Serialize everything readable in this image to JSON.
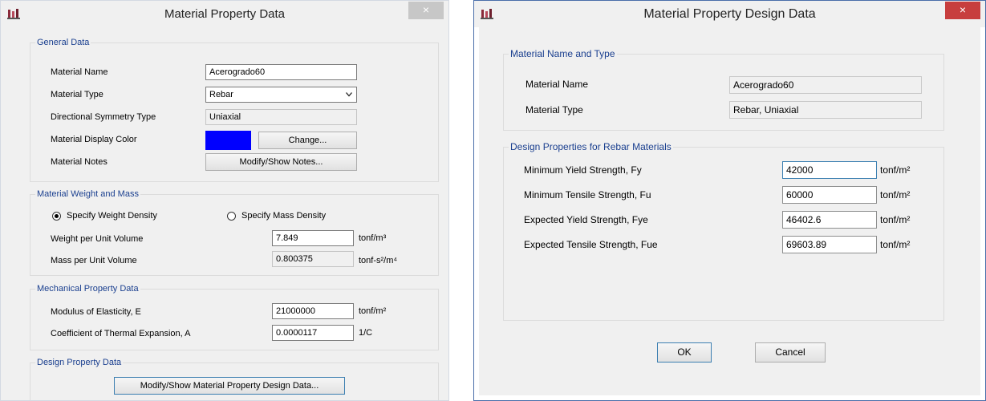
{
  "left_dialog": {
    "title": "Material Property Data",
    "close_label": "×",
    "general": {
      "legend": "General Data",
      "material_name_label": "Material Name",
      "material_name_value": "Acerogrado60",
      "material_type_label": "Material Type",
      "material_type_value": "Rebar",
      "symmetry_label": "Directional Symmetry Type",
      "symmetry_value": "Uniaxial",
      "display_color_label": "Material Display Color",
      "display_color": "#0000ff",
      "change_button": "Change...",
      "notes_label": "Material Notes",
      "notes_button": "Modify/Show Notes..."
    },
    "weight_mass": {
      "legend": "Material Weight and Mass",
      "radio_weight_label": "Specify Weight Density",
      "radio_mass_label": "Specify Mass Density",
      "weight_label": "Weight per Unit Volume",
      "weight_value": "7.849",
      "weight_unit": "tonf/m³",
      "mass_label": "Mass per Unit Volume",
      "mass_value": "0.800375",
      "mass_unit": "tonf-s²/m⁴"
    },
    "mechanical": {
      "legend": "Mechanical Property Data",
      "modulus_label": "Modulus of Elasticity,  E",
      "modulus_value": "21000000",
      "modulus_unit": "tonf/m²",
      "thermal_label": "Coefficient of Thermal Expansion,  A",
      "thermal_value": "0.0000117",
      "thermal_unit": "1/C"
    },
    "design": {
      "legend": "Design Property Data",
      "button": "Modify/Show Material Property Design Data..."
    }
  },
  "right_dialog": {
    "title": "Material Property Design Data",
    "close_label": "×",
    "name_type": {
      "legend": "Material Name and Type",
      "name_label": "Material Name",
      "name_value": "Acerogrado60",
      "type_label": "Material Type",
      "type_value": "Rebar, Uniaxial"
    },
    "rebar": {
      "legend": "Design Properties for Rebar Materials",
      "fy_label": "Minimum Yield Strength, Fy",
      "fy_value": "42000",
      "fu_label": "Minimum Tensile Strength, Fu",
      "fu_value": "60000",
      "fye_label": "Expected Yield Strength, Fye",
      "fye_value": "46402.6",
      "fue_label": "Expected Tensile Strength, Fue",
      "fue_value": "69603.89",
      "unit": "tonf/m²"
    },
    "ok_button": "OK",
    "cancel_button": "Cancel"
  }
}
